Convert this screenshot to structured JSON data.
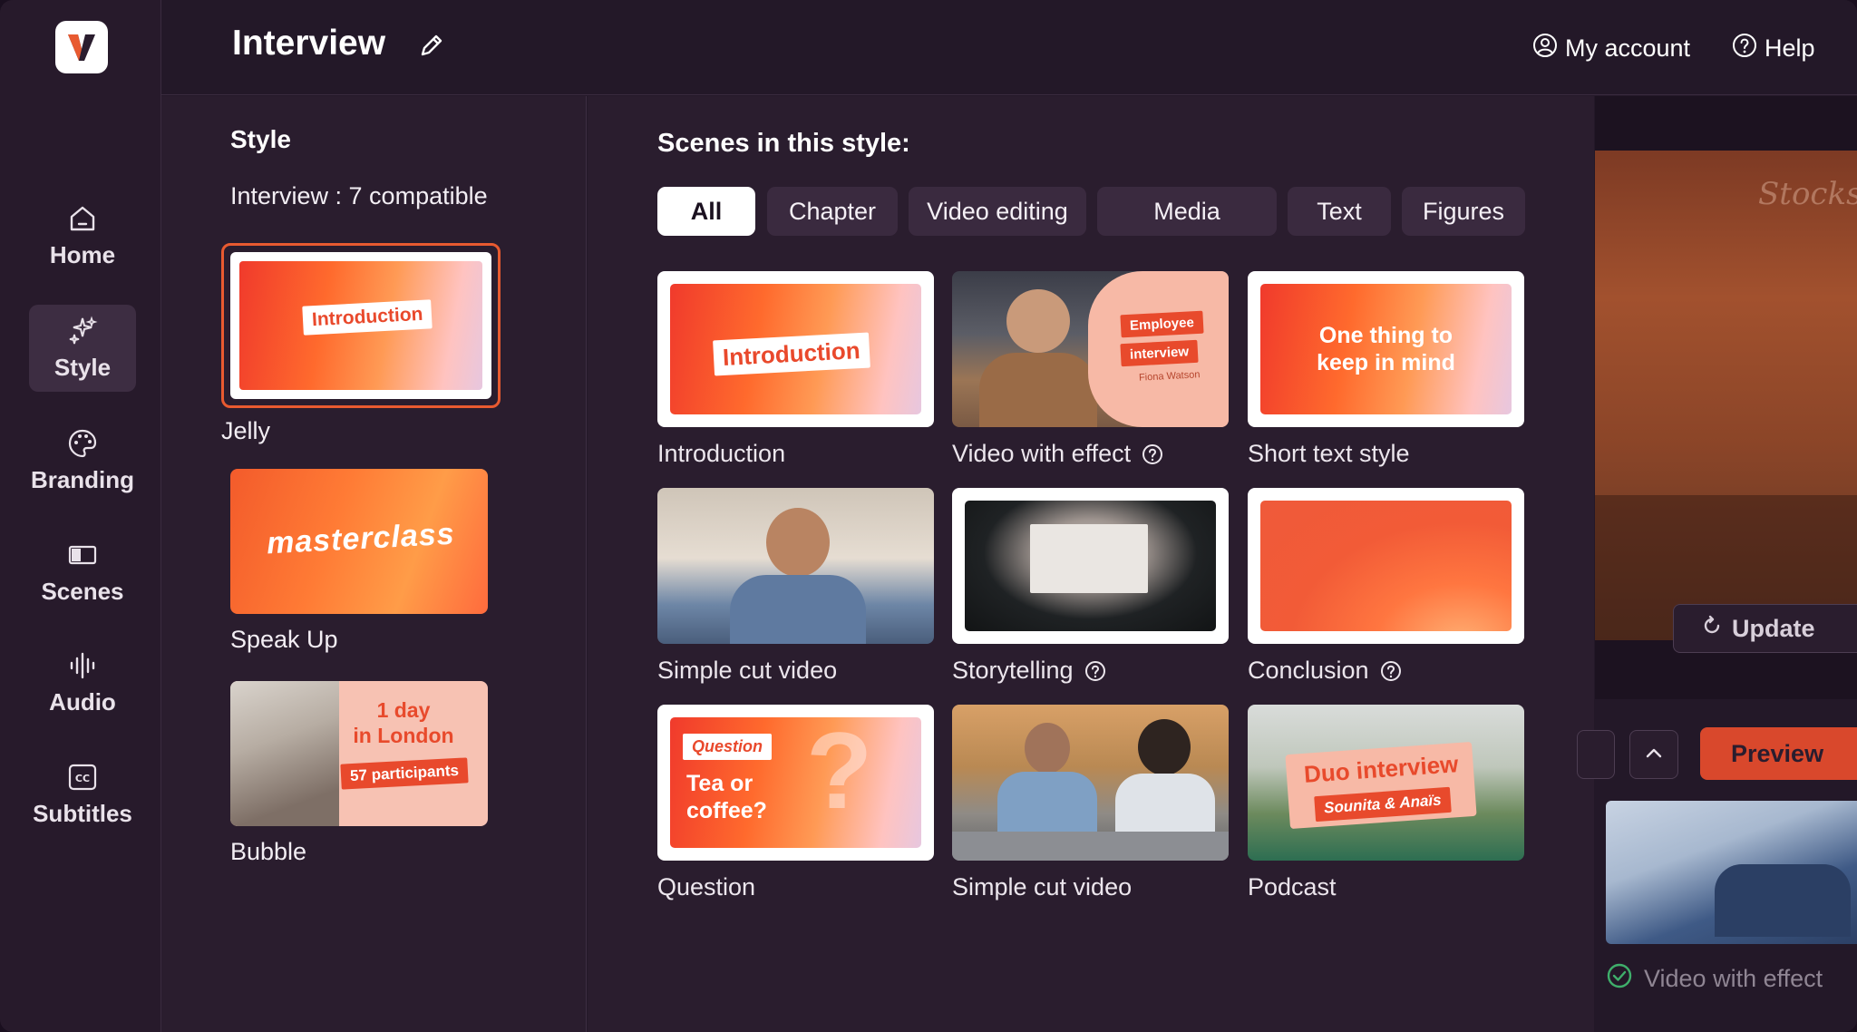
{
  "app": {
    "title": "Interview"
  },
  "nav": {
    "items": [
      {
        "label": "Home",
        "icon": "home-icon"
      },
      {
        "label": "Style",
        "icon": "sparkles-icon"
      },
      {
        "label": "Branding",
        "icon": "palette-icon"
      },
      {
        "label": "Scenes",
        "icon": "scenes-icon"
      },
      {
        "label": "Audio",
        "icon": "waveform-icon"
      },
      {
        "label": "Subtitles",
        "icon": "cc-icon"
      }
    ],
    "active": "Style"
  },
  "header": {
    "my_account": "My account",
    "help": "Help"
  },
  "style_panel": {
    "title": "Style",
    "compatible": "Interview : 7 compatible",
    "styles": [
      {
        "name": "Jelly",
        "thumb_text": "Introduction",
        "selected": true
      },
      {
        "name": "Speak Up",
        "thumb_text": "masterclass"
      },
      {
        "name": "Bubble",
        "thumb_line1": "1 day",
        "thumb_line2": "in London",
        "thumb_line3": "57 participants"
      }
    ]
  },
  "scenes_panel": {
    "title": "Scenes in this style:",
    "filters": [
      "All",
      "Chapter",
      "Video editing",
      "Media",
      "Text",
      "Figures"
    ],
    "active_filter": "All",
    "scenes": [
      {
        "label": "Introduction",
        "thumb_text": "Introduction"
      },
      {
        "label": "Video with effect",
        "thumb_line1": "Employee",
        "thumb_line2": "interview",
        "thumb_line3": "Fiona Watson",
        "help": true
      },
      {
        "label": "Short text style",
        "thumb_text": "One thing to keep in mind"
      },
      {
        "label": "Simple cut video"
      },
      {
        "label": "Storytelling",
        "help": true
      },
      {
        "label": "Conclusion",
        "help": true
      },
      {
        "label": "Question",
        "thumb_tag": "Question",
        "thumb_text": "Tea or coffee?"
      },
      {
        "label": "Simple cut video"
      },
      {
        "label": "Podcast",
        "thumb_line1": "Duo interview",
        "thumb_line2": "Sounita & Anaïs"
      }
    ]
  },
  "preview": {
    "update": "Update",
    "preview": "Preview",
    "current_scene": "Video with effect",
    "watermark": "Stocksy"
  },
  "colors": {
    "accent": "#e85a30",
    "preview_button": "#d9482c",
    "background": "#2a1d2e"
  }
}
